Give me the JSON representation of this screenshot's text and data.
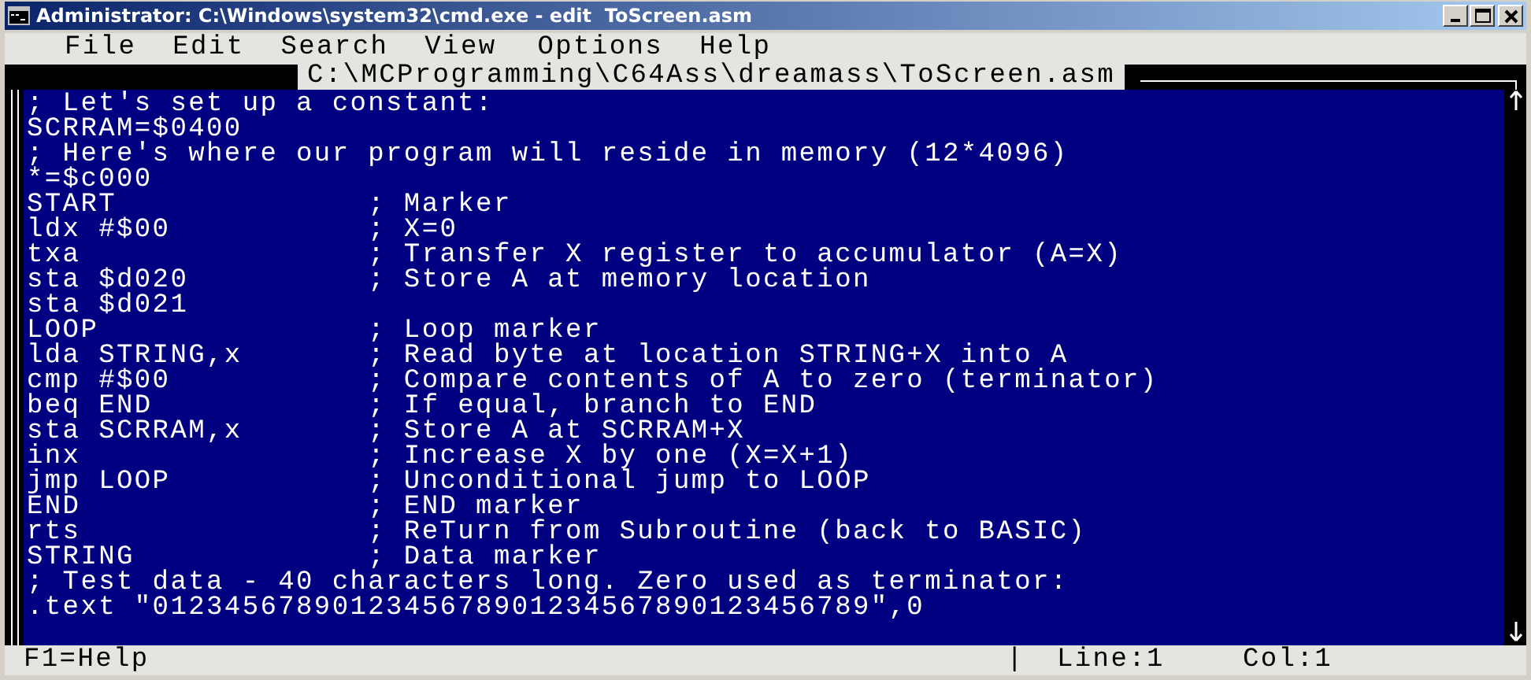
{
  "window": {
    "title": "Administrator: C:\\Windows\\system32\\cmd.exe - edit  ToScreen.asm"
  },
  "menu": [
    "File",
    "Edit",
    "Search",
    "View",
    "Options",
    "Help"
  ],
  "editor": {
    "file_path": "C:\\MCProgramming\\C64Ass\\dreamass\\ToScreen.asm",
    "lines": [
      "; Let's set up a constant:",
      "SCRRAM=$0400",
      "; Here's where our program will reside in memory (12*4096)",
      "*=$c000",
      "START              ; Marker",
      "ldx #$00           ; X=0",
      "txa                ; Transfer X register to accumulator (A=X)",
      "sta $d020          ; Store A at memory location",
      "sta $d021",
      "LOOP               ; Loop marker",
      "lda STRING,x       ; Read byte at location STRING+X into A",
      "cmp #$00           ; Compare contents of A to zero (terminator)",
      "beq END            ; If equal, branch to END",
      "sta SCRRAM,x       ; Store A at SCRRAM+X",
      "inx                ; Increase X by one (X=X+1)",
      "jmp LOOP           ; Unconditional jump to LOOP",
      "END                ; END marker",
      "rts                ; ReTurn from Subroutine (back to BASIC)",
      "STRING             ; Data marker",
      "; Test data - 40 characters long. Zero used as terminator:",
      ".text \"0123456789012345678901234567890123456789\",0"
    ]
  },
  "status_bar": {
    "help": "F1=Help",
    "separator": "|",
    "line": "Line:1",
    "col": "Col:1"
  }
}
